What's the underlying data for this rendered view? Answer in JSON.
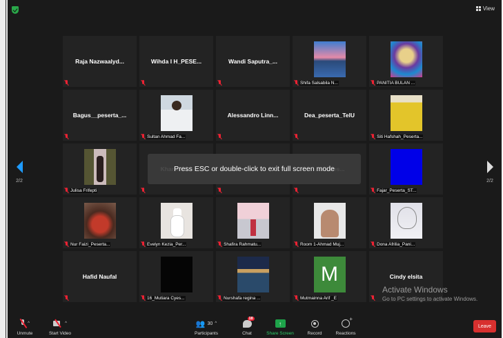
{
  "header": {
    "view_label": "View"
  },
  "pagination": {
    "prev_page": "2/2",
    "next_page": "2/2"
  },
  "participants": [
    {
      "display": "Raja  Nazwaalyd...",
      "label": "",
      "pic": ""
    },
    {
      "display": "Wihda I H_PESE...",
      "label": "",
      "pic": ""
    },
    {
      "display": "Wandi  Saputra_...",
      "label": "",
      "pic": ""
    },
    {
      "display": "",
      "label": "Shifa Salsabila N...",
      "pic": "p-lake"
    },
    {
      "display": "",
      "label": "PANITIA BULAN ...",
      "pic": "p-joker"
    },
    {
      "display": "Bagus__peserta_...",
      "label": "",
      "pic": ""
    },
    {
      "display": "",
      "label": "Sultan Ahmad Fa...",
      "pic": "p-person"
    },
    {
      "display": "Alessandro  Linn...",
      "label": "",
      "pic": ""
    },
    {
      "display": "Dea_peserta_TelU",
      "label": "",
      "pic": ""
    },
    {
      "display": "",
      "label": "Siti Hafshah_Peserta...",
      "pic": "p-yellow"
    },
    {
      "display": "",
      "label": "Julisa Frifepti",
      "pic": "p-girl"
    },
    {
      "display": "Kharisma...",
      "label": "",
      "pic": ""
    },
    {
      "display": "",
      "label": "",
      "pic": ""
    },
    {
      "display": "...ah_Pes...",
      "label": "",
      "pic": ""
    },
    {
      "display": "",
      "label": "Fajar_Peserta_ST...",
      "pic": "p-blue"
    },
    {
      "display": "",
      "label": "Nur Faizi_Peserta...",
      "pic": "p-food"
    },
    {
      "display": "",
      "label": "Evelyn Kezia_Per...",
      "pic": "p-bunny"
    },
    {
      "display": "",
      "label": "Shafira Rahmatu...",
      "pic": "p-pink"
    },
    {
      "display": "",
      "label": "Room 1-Ahmad Muj...",
      "pic": "p-man"
    },
    {
      "display": "",
      "label": "Dona Afrilia_Pani...",
      "pic": "p-sketch"
    },
    {
      "display": "Hafid Naufal",
      "label": "",
      "pic": ""
    },
    {
      "display": "",
      "label": "16_Mutiara Cyes...",
      "pic": "p-black"
    },
    {
      "display": "",
      "label": "Nurshafa regina ...",
      "pic": "p-harbor"
    },
    {
      "display": "",
      "label": "Mutmainna Arif _E",
      "pic": "p-m"
    },
    {
      "display": "Cindy elsita",
      "label": "",
      "pic": ""
    }
  ],
  "avatar_letter": "M",
  "toast": "Press ESC or double-click to exit full screen mode",
  "watermark": {
    "title": "Activate Windows",
    "subtitle": "Go to PC settings to activate Windows."
  },
  "toolbar": {
    "unmute": "Unmute",
    "start_video": "Start Video",
    "participants": "Participants",
    "participants_count": "30",
    "chat": "Chat",
    "chat_badge": "18",
    "share_screen": "Share Screen",
    "record": "Record",
    "reactions": "Reactions",
    "leave": "Leave"
  },
  "colors": {
    "accent": "#1e9bff",
    "share": "#1ea34a",
    "leave": "#d8302f",
    "muted": "#e22233"
  }
}
